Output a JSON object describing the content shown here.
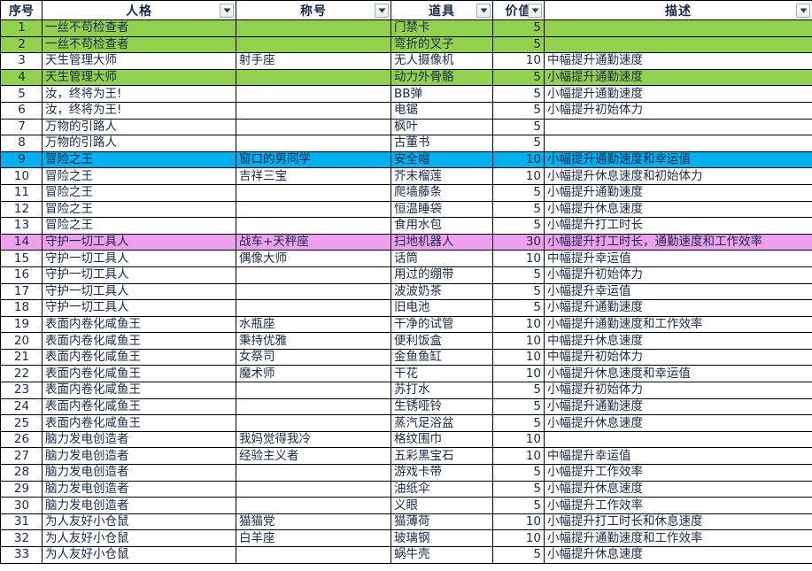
{
  "sheet": {
    "columns": [
      {
        "key": "seq",
        "label": "序号",
        "filter": false
      },
      {
        "key": "pers",
        "label": "人格",
        "filter": true
      },
      {
        "key": "title",
        "label": "称号",
        "filter": true
      },
      {
        "key": "item",
        "label": "道具",
        "filter": true
      },
      {
        "key": "val",
        "label": "价值",
        "filter": true
      },
      {
        "key": "desc",
        "label": "描述",
        "filter": true
      }
    ],
    "filter_icon": "chevron-down-icon",
    "colors": {
      "highlight_green": "#92D050",
      "highlight_blue": "#00B0F0",
      "highlight_pink": "#EDA0ED",
      "grid_line": "#000000",
      "text": "#1b2a4a",
      "cell_background": "#ffffff"
    },
    "rows": [
      {
        "seq": "1",
        "pers": "一丝不苟检查者",
        "title": "",
        "item": "门禁卡",
        "val": "5",
        "desc": "",
        "hl": "green"
      },
      {
        "seq": "2",
        "pers": "一丝不苟检查者",
        "title": "",
        "item": "弯折的叉子",
        "val": "5",
        "desc": "",
        "hl": "green"
      },
      {
        "seq": "3",
        "pers": "天生管理大师",
        "title": "射手座",
        "item": "无人摄像机",
        "val": "10",
        "desc": "中幅提升通勤速度",
        "hl": "none"
      },
      {
        "seq": "4",
        "pers": "天生管理大师",
        "title": "",
        "item": "动力外骨骼",
        "val": "5",
        "desc": "小幅提升通勤速度",
        "hl": "green"
      },
      {
        "seq": "5",
        "pers": "汝，终将为王!",
        "title": "",
        "item": "BB弹",
        "val": "5",
        "desc": "小幅提升通勤速度",
        "hl": "none"
      },
      {
        "seq": "6",
        "pers": "汝，终将为王!",
        "title": "",
        "item": "电锯",
        "val": "5",
        "desc": "小幅提升初始体力",
        "hl": "none"
      },
      {
        "seq": "7",
        "pers": "万物的引路人",
        "title": "",
        "item": "枫叶",
        "val": "5",
        "desc": "",
        "hl": "none"
      },
      {
        "seq": "8",
        "pers": "万物的引路人",
        "title": "",
        "item": "古董书",
        "val": "5",
        "desc": "",
        "hl": "none"
      },
      {
        "seq": "9",
        "pers": "冒险之王",
        "title": "窗口的男同学",
        "item": "安全帽",
        "val": "10",
        "desc": "小幅提升通勤速度和幸运值",
        "hl": "blue"
      },
      {
        "seq": "10",
        "pers": "冒险之王",
        "title": "吉祥三宝",
        "item": "芥末榴莲",
        "val": "10",
        "desc": "小幅提升休息速度和初始体力",
        "hl": "none"
      },
      {
        "seq": "11",
        "pers": "冒险之王",
        "title": "",
        "item": "爬墙藤条",
        "val": "5",
        "desc": "小幅提升通勤速度",
        "hl": "none"
      },
      {
        "seq": "12",
        "pers": "冒险之王",
        "title": "",
        "item": "恒温睡袋",
        "val": "5",
        "desc": "小幅提升休息速度",
        "hl": "none"
      },
      {
        "seq": "13",
        "pers": "冒险之王",
        "title": "",
        "item": "食用水包",
        "val": "5",
        "desc": "小幅提升打工时长",
        "hl": "none"
      },
      {
        "seq": "14",
        "pers": "守护一切工具人",
        "title": "战车+天秤座",
        "item": "扫地机器人",
        "val": "30",
        "desc": "小幅提升打工时长，通勤速度和工作效率",
        "hl": "pink"
      },
      {
        "seq": "15",
        "pers": "守护一切工具人",
        "title": "偶像大师",
        "item": "话筒",
        "val": "10",
        "desc": "中幅提升幸运值",
        "hl": "none"
      },
      {
        "seq": "16",
        "pers": "守护一切工具人",
        "title": "",
        "item": "用过的绷带",
        "val": "5",
        "desc": "小幅提升初始体力",
        "hl": "none"
      },
      {
        "seq": "17",
        "pers": "守护一切工具人",
        "title": "",
        "item": "波波奶茶",
        "val": "5",
        "desc": "小幅提升幸运值",
        "hl": "none"
      },
      {
        "seq": "18",
        "pers": "守护一切工具人",
        "title": "",
        "item": "旧电池",
        "val": "5",
        "desc": "小幅提升通勤速度",
        "hl": "none"
      },
      {
        "seq": "19",
        "pers": "表面内卷化咸鱼王",
        "title": "水瓶座",
        "item": "干净的试管",
        "val": "10",
        "desc": "小幅提升通勤速度和工作效率",
        "hl": "none"
      },
      {
        "seq": "20",
        "pers": "表面内卷化咸鱼王",
        "title": "秉持优雅",
        "item": "便利饭盒",
        "val": "10",
        "desc": "中幅提升休息速度",
        "hl": "none"
      },
      {
        "seq": "21",
        "pers": "表面内卷化咸鱼王",
        "title": "女祭司",
        "item": "金鱼鱼缸",
        "val": "10",
        "desc": "中幅提升初始体力",
        "hl": "none"
      },
      {
        "seq": "22",
        "pers": "表面内卷化咸鱼王",
        "title": "魔术师",
        "item": "干花",
        "val": "10",
        "desc": "小幅提升休息速度和幸运值",
        "hl": "none"
      },
      {
        "seq": "23",
        "pers": "表面内卷化咸鱼王",
        "title": "",
        "item": "苏打水",
        "val": "5",
        "desc": "小幅提升初始体力",
        "hl": "none"
      },
      {
        "seq": "24",
        "pers": "表面内卷化咸鱼王",
        "title": "",
        "item": "生锈哑铃",
        "val": "5",
        "desc": "小幅提升通勤速度",
        "hl": "none"
      },
      {
        "seq": "25",
        "pers": "表面内卷化咸鱼王",
        "title": "",
        "item": "蒸汽足浴盆",
        "val": "5",
        "desc": "小幅提升休息速度",
        "hl": "none"
      },
      {
        "seq": "26",
        "pers": "脑力发电创造者",
        "title": "我妈觉得我冷",
        "item": "格纹围巾",
        "val": "10",
        "desc": "",
        "hl": "none"
      },
      {
        "seq": "27",
        "pers": "脑力发电创造者",
        "title": "经验主义者",
        "item": "五彩黑宝石",
        "val": "10",
        "desc": "中幅提升幸运值",
        "hl": "none"
      },
      {
        "seq": "28",
        "pers": "脑力发电创造者",
        "title": "",
        "item": "游戏卡带",
        "val": "5",
        "desc": "小幅提升工作效率",
        "hl": "none"
      },
      {
        "seq": "29",
        "pers": "脑力发电创造者",
        "title": "",
        "item": "油纸伞",
        "val": "5",
        "desc": "小幅提升休息速度",
        "hl": "none"
      },
      {
        "seq": "30",
        "pers": "脑力发电创造者",
        "title": "",
        "item": "义眼",
        "val": "5",
        "desc": "小幅提升工作效率",
        "hl": "none"
      },
      {
        "seq": "31",
        "pers": "为人友好小仓鼠",
        "title": "猫猫党",
        "item": "猫薄荷",
        "val": "10",
        "desc": "小幅提升打工时长和休息速度",
        "hl": "none"
      },
      {
        "seq": "32",
        "pers": "为人友好小仓鼠",
        "title": "白羊座",
        "item": "玻璃钢",
        "val": "10",
        "desc": "小幅提升通勤速度和工作效率",
        "hl": "none"
      },
      {
        "seq": "33",
        "pers": "为人友好小仓鼠",
        "title": "",
        "item": "蜗牛壳",
        "val": "5",
        "desc": "小幅提升休息速度",
        "hl": "none"
      }
    ]
  }
}
